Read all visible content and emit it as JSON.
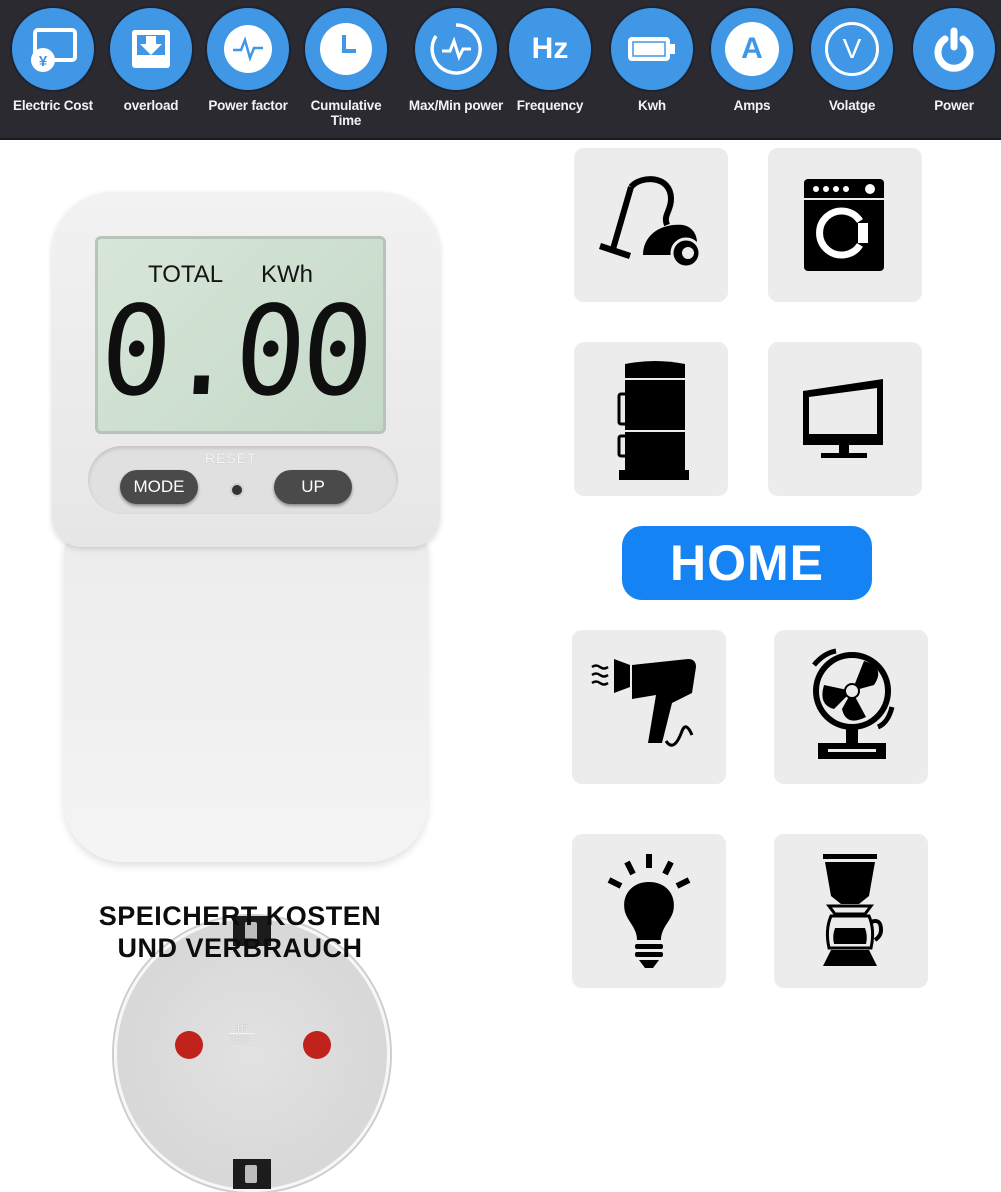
{
  "features": [
    {
      "label": "Electric Cost",
      "icon": "electric-cost-icon"
    },
    {
      "label": "overload",
      "icon": "overload-icon"
    },
    {
      "label": "Power factor",
      "icon": "power-factor-icon"
    },
    {
      "label": "Cumulative Time",
      "icon": "clock-icon"
    },
    {
      "label": "Max/Min power",
      "icon": "max-min-power-icon"
    },
    {
      "label": "Frequency",
      "icon": "hz-icon"
    },
    {
      "label": "Kwh",
      "icon": "battery-icon"
    },
    {
      "label": "Amps",
      "icon": "amps-icon"
    },
    {
      "label": "Volatge",
      "icon": "voltage-icon"
    },
    {
      "label": "Power",
      "icon": "power-icon"
    }
  ],
  "feature_icon_text": {
    "hz": "Hz",
    "amps": "A",
    "volt": "V",
    "yen": "¥"
  },
  "device": {
    "lcd_label": "TOTAL",
    "lcd_unit": "KWh",
    "lcd_value": "0.00",
    "reset_label": "RESET",
    "mode_button": "MODE",
    "up_button": "UP",
    "socket_rating_top": "16",
    "socket_rating_bottom": "250~"
  },
  "slogan_line1": "SPEICHERT KOSTEN",
  "slogan_line2": "UND VERBRAUCH",
  "home_label": "HOME",
  "appliances": [
    "vacuum-cleaner",
    "washing-machine",
    "refrigerator",
    "television",
    "hair-dryer",
    "fan",
    "light-bulb",
    "coffee-maker"
  ],
  "colors": {
    "accent_blue": "#1683f5",
    "icon_blue": "#3f97e6",
    "top_bar": "#2a2a30",
    "lcd_green": "#cfe0d1",
    "pin_red": "#c0221c"
  }
}
